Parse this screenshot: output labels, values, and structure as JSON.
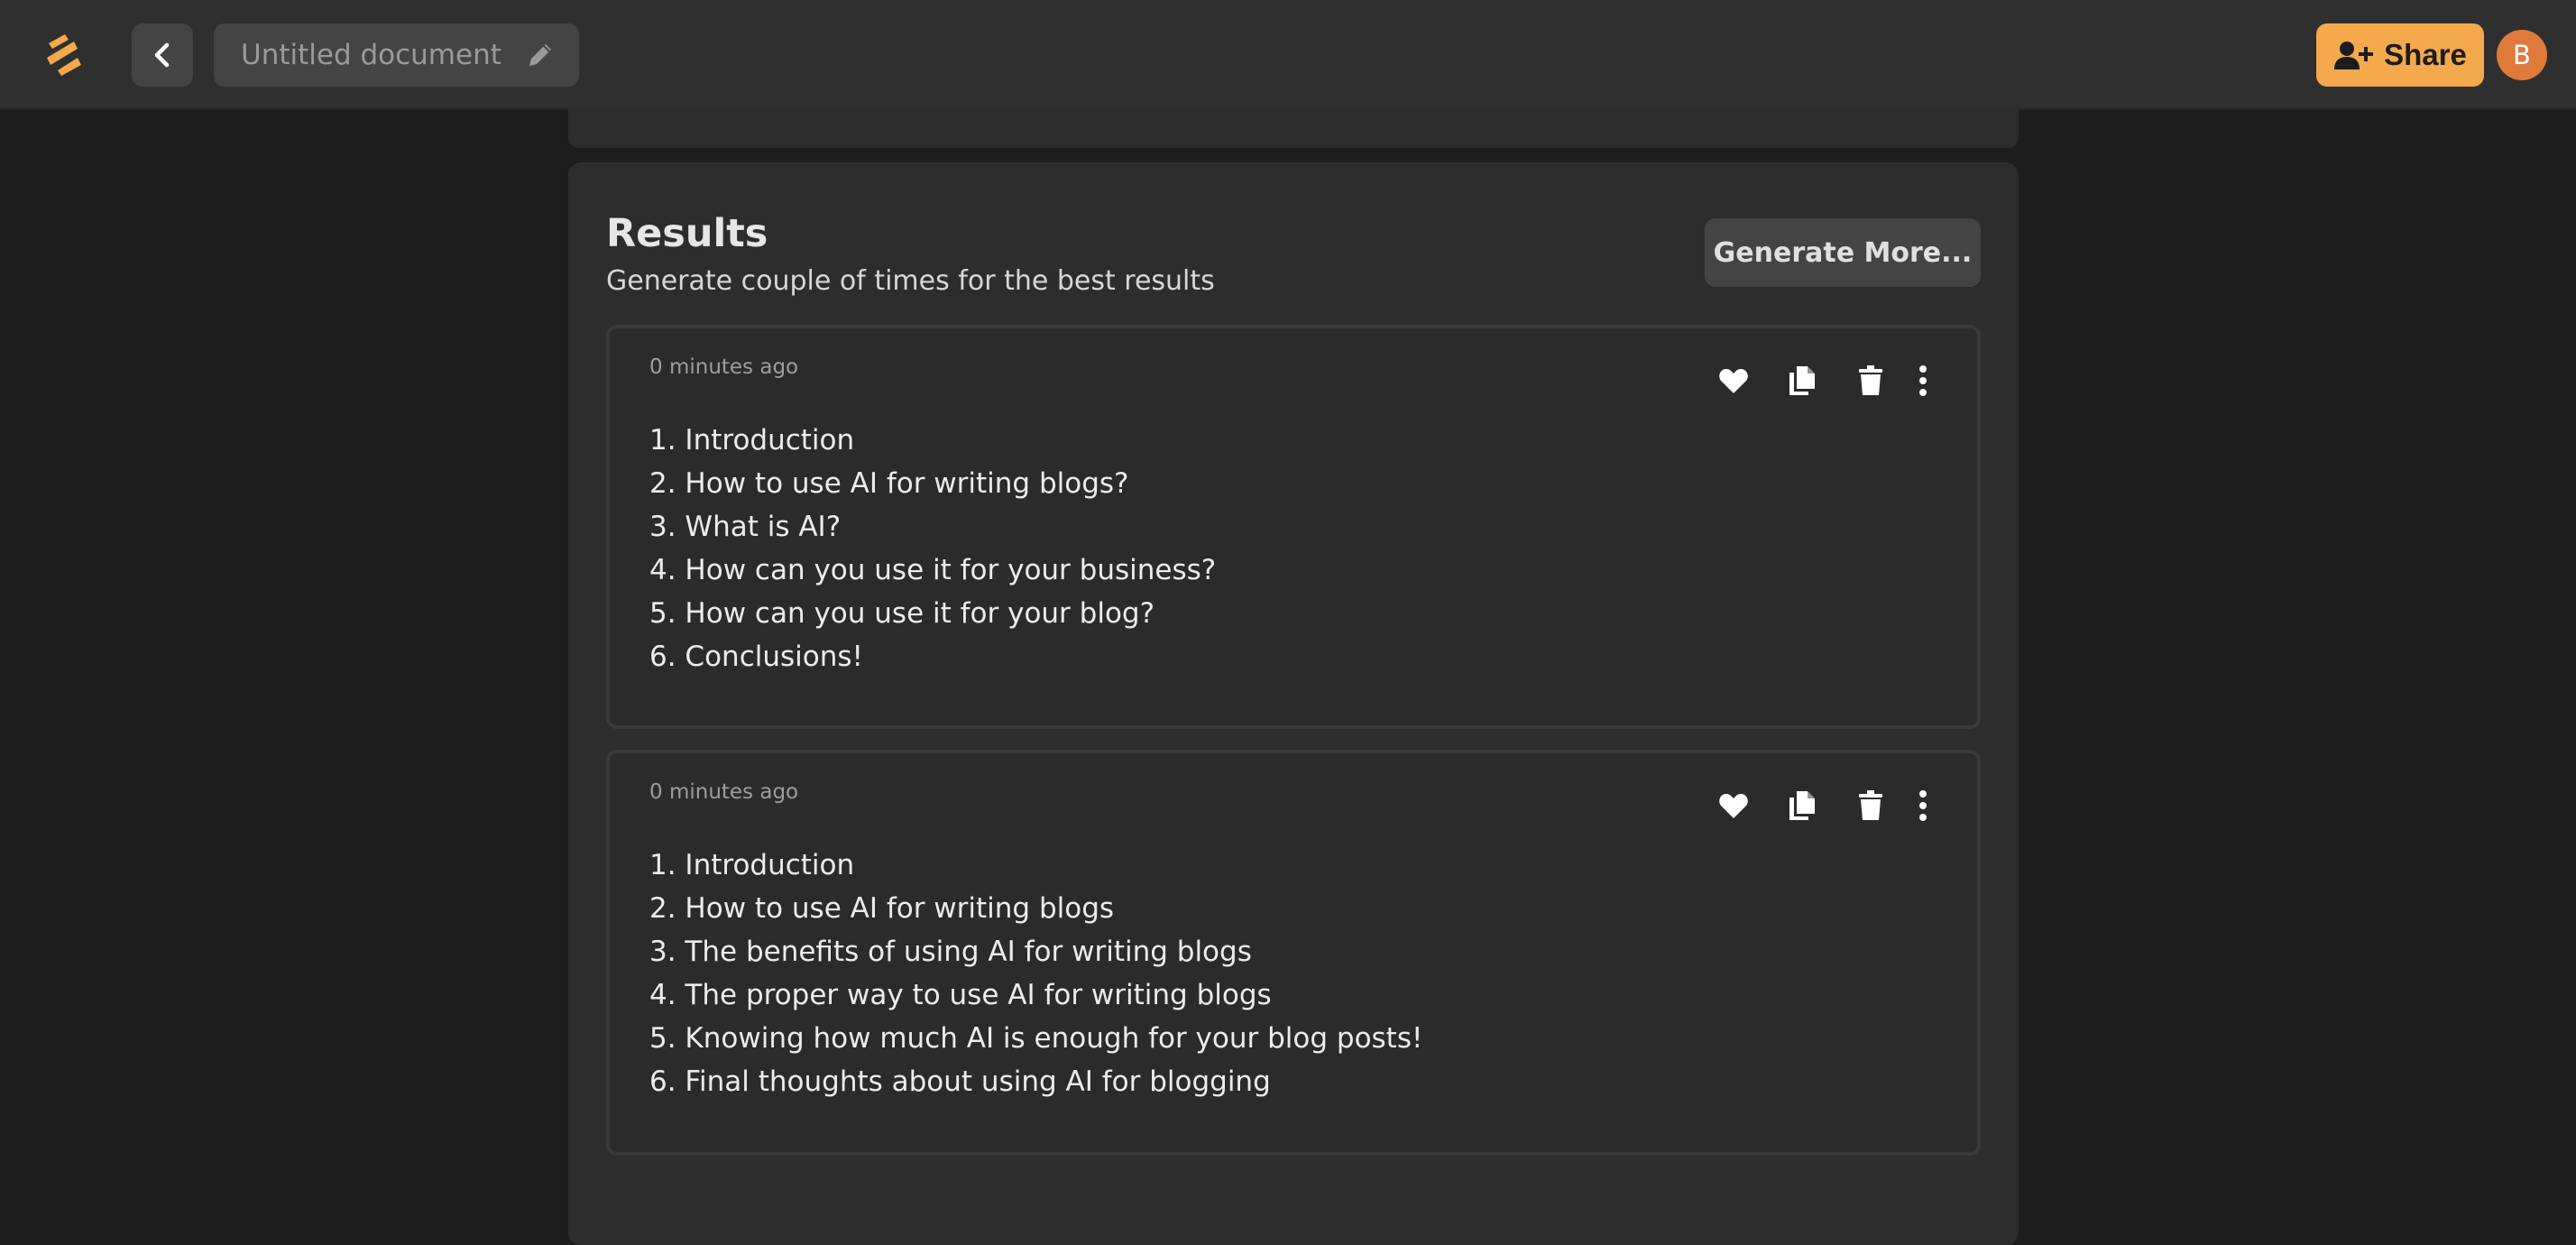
{
  "header": {
    "document_title": "Untitled document",
    "share_label": "Share",
    "avatar_initial": "B",
    "accent_color": "#f3a94c"
  },
  "results": {
    "title": "Results",
    "subtitle": "Generate couple of times for the best results",
    "generate_more_label": "Generate More...",
    "cards": [
      {
        "time": "0 minutes ago",
        "items": [
          "1. Introduction",
          "2. How to use AI for writing blogs?",
          "3. What is AI?",
          "4. How can you use it for your business?",
          "5. How can you use it for your blog?",
          "6. Conclusions!"
        ]
      },
      {
        "time": "0 minutes ago",
        "items": [
          "1. Introduction",
          "2. How to use AI for writing blogs",
          "3. The benefits of using AI for writing blogs",
          "4. The proper way to use AI for writing blogs",
          "5. Knowing how much AI is enough for your blog posts!",
          "6. Final thoughts about using AI for blogging"
        ]
      }
    ]
  },
  "icons": {
    "logo": "app-logo-icon",
    "back": "chevron-left-icon",
    "edit": "pencil-icon",
    "share": "user-plus-icon",
    "like": "heart-icon",
    "copy": "copy-icon",
    "delete": "trash-icon",
    "more": "more-vertical-icon"
  }
}
